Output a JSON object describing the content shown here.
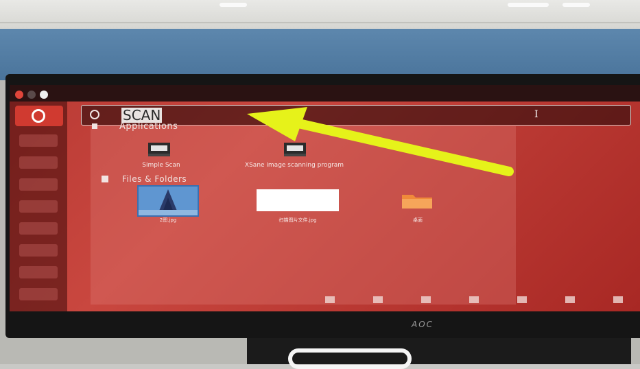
{
  "search": {
    "query": "SCAN",
    "cursor_glyph": "I"
  },
  "sections": {
    "applications": "Applications",
    "files": "Files & Folders"
  },
  "apps": [
    {
      "label": "Simple Scan",
      "icon": "scanner-icon"
    },
    {
      "label": "XSane image scanning program",
      "icon": "scanner-icon"
    }
  ],
  "files": [
    {
      "label": "2图.jpg",
      "icon": "image-thumbnail"
    },
    {
      "label": "扫描图片文件.jpg",
      "icon": "image-thumbnail"
    },
    {
      "label": "桌面",
      "icon": "folder-icon"
    }
  ],
  "monitor": {
    "brand": "AOC"
  },
  "colors": {
    "accent_red": "#c9473f",
    "highlight_arrow": "#e6f21a",
    "folder_orange": "#f08a3a"
  }
}
